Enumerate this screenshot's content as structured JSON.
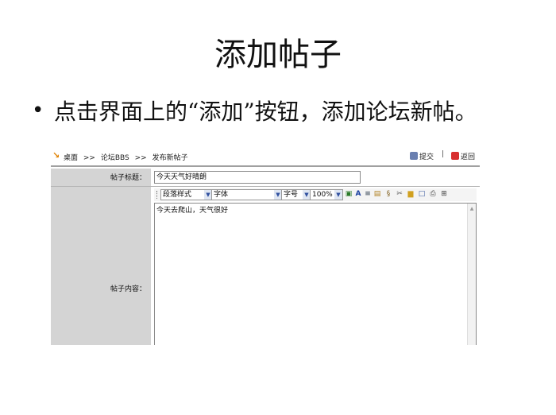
{
  "slide": {
    "title": "添加帖子",
    "bullet": "点击界面上的“添加”按钮，添加论坛新帖。"
  },
  "breadcrumb": {
    "items": [
      "桌面",
      ">>",
      "论坛BBS",
      ">>",
      "发布新帖子"
    ]
  },
  "actions": {
    "submit_label": "提交",
    "separator": "|",
    "back_label": "返回"
  },
  "form": {
    "title_label": "帖子标题：",
    "title_value": "今天天气好晴朗",
    "content_label": "帖子内容：",
    "content_value": "今天去爬山，天气很好"
  },
  "toolbar": {
    "paragraph_style": "段落样式",
    "font": "字体",
    "font_size": "字号",
    "zoom": "100%",
    "icons": [
      "insert-image-icon",
      "font-color-icon",
      "align-icon",
      "table-icon",
      "special-char-icon",
      "tools-icon",
      "note-icon",
      "frame-icon",
      "print-icon",
      "grid-icon"
    ]
  },
  "colors": {
    "label_bg": "#d4d4d4",
    "breadcrumb_arrow": "#e08000",
    "back_icon": "#d83030"
  }
}
